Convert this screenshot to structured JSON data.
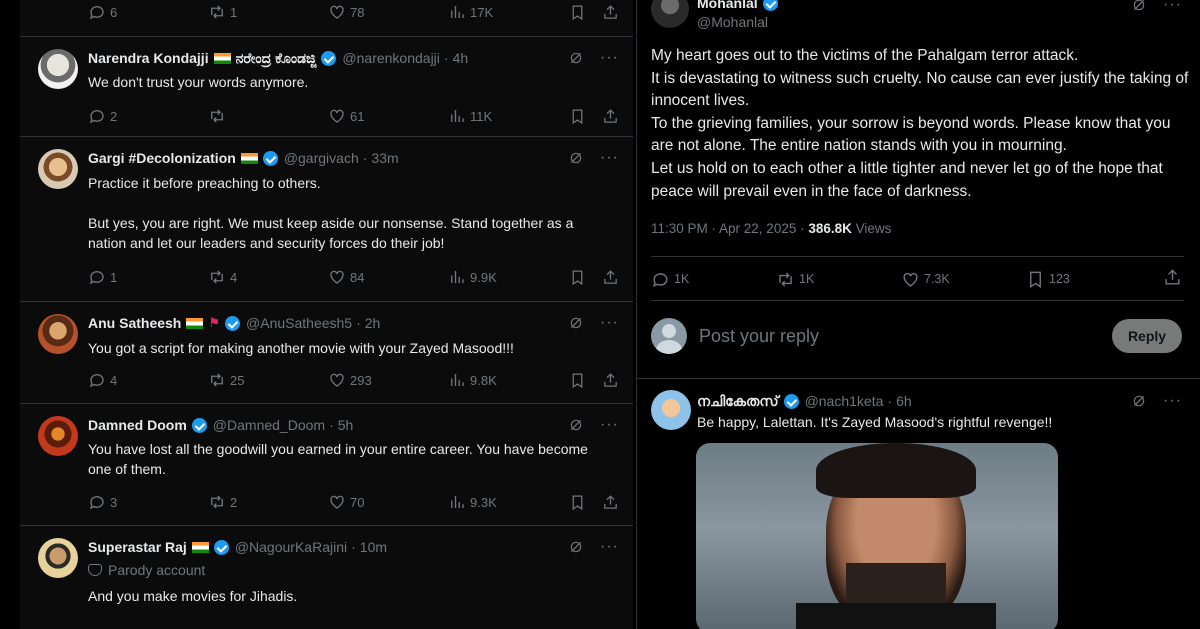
{
  "left_top_actions": {
    "replies": "6",
    "reposts": "1",
    "likes": "78",
    "views": "17K"
  },
  "tweets": [
    {
      "name": "Narendra Kondajji",
      "name_suffix": "ನರೇಂದ್ರ ಕೊಂಡಜ್ಜಿ",
      "handle": "@narenkondajji",
      "time": "4h",
      "text": "We don't trust your words anymore.",
      "replies": "2",
      "reposts": "",
      "likes": "61",
      "views": "11K"
    },
    {
      "name": "Gargi #Decolonization",
      "handle": "@gargivach",
      "time": "33m",
      "text": "Practice it before preaching to others.\n\nBut yes, you are right. We must keep aside our nonsense. Stand together as a nation and let our leaders and security forces do their job!",
      "replies": "1",
      "reposts": "4",
      "likes": "84",
      "views": "9.9K"
    },
    {
      "name": "Anu Satheesh",
      "handle": "@AnuSatheesh5",
      "time": "2h",
      "text": "You got a script for making another movie with your Zayed Masood!!!",
      "replies": "4",
      "reposts": "25",
      "likes": "293",
      "views": "9.8K"
    },
    {
      "name": "Damned Doom",
      "handle": "@Damned_Doom",
      "time": "5h",
      "text": "You have lost all the goodwill you earned in your entire career. You have become one of them.",
      "replies": "3",
      "reposts": "2",
      "likes": "70",
      "views": "9.3K"
    },
    {
      "name": "Superastar Raj",
      "handle": "@NagourKaRajini",
      "time": "10m",
      "label": "Parody account",
      "text": "And you make movies for Jihadis."
    }
  ],
  "main_post": {
    "author_name": "Mohanlal",
    "author_handle": "@Mohanlal",
    "text": "My heart goes out to the victims of the Pahalgam terror attack.\nIt is devastating to witness such cruelty. No cause can ever justify the taking of innocent lives.\nTo the grieving families, your sorrow is beyond words. Please know that you are not alone. The entire nation stands with you in mourning.\nLet us hold on to each other a little tighter and never let go of the hope that peace will prevail even in the face of darkness.",
    "time": "11:30 PM · Apr 22, 2025 · ",
    "views": "386.8K",
    "views_label": " Views",
    "replies": "1K",
    "reposts": "1K",
    "likes": "7.3K",
    "bookmarks": "123"
  },
  "reply_box": {
    "placeholder": "Post your reply",
    "button": "Reply"
  },
  "reply_tweet": {
    "name": "നചികേതസ്",
    "handle": "@nach1keta",
    "time": "6h",
    "text": "Be happy, Lalettan. It's Zayed Masood's rightful revenge!!"
  }
}
